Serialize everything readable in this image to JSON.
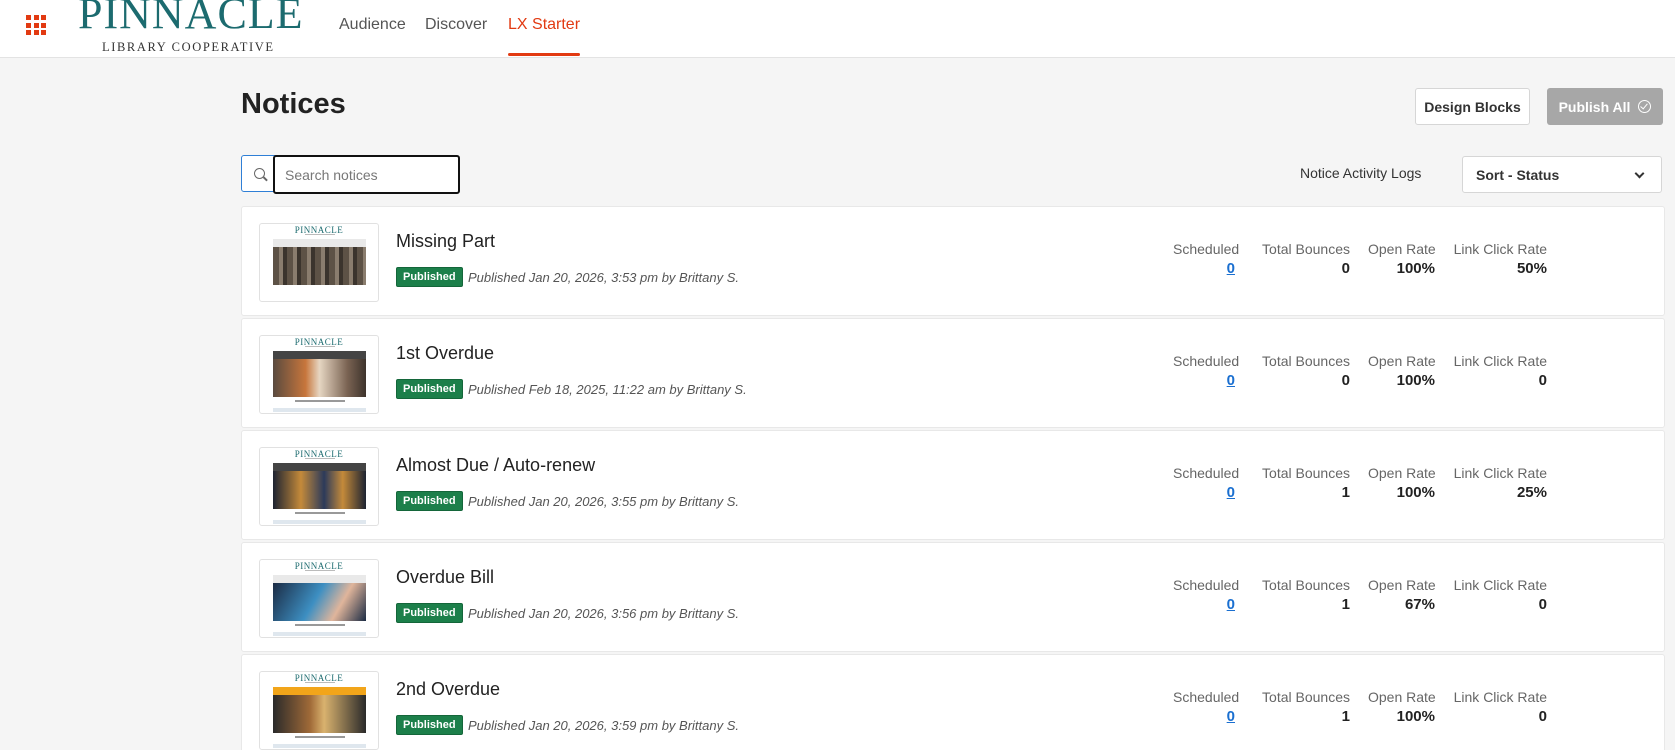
{
  "nav": {
    "logo_main": "PINNACLE",
    "logo_sub": "LIBRARY COOPERATIVE",
    "tabs": [
      {
        "label": "Audience",
        "active": false
      },
      {
        "label": "Discover",
        "active": false
      },
      {
        "label": "LX Starter",
        "active": true
      }
    ],
    "accent_color": "#e23a12"
  },
  "header": {
    "title": "Notices",
    "design_blocks_label": "Design Blocks",
    "publish_all_label": "Publish All"
  },
  "toolbar": {
    "search_placeholder": "Search notices",
    "search_value": "",
    "activity_logs_label": "Notice Activity Logs",
    "sort_label": "Sort - Status"
  },
  "stat_labels": {
    "scheduled": "Scheduled",
    "total_bounces": "Total Bounces",
    "open_rate": "Open Rate",
    "link_click_rate": "Link Click Rate"
  },
  "notices": [
    {
      "title": "Missing Part",
      "status": "Published",
      "meta": "Published Jan 20, 2026, 3:53 pm by Brittany  S.",
      "thumb_logo": "PINNACLE",
      "scheduled": "0",
      "total_bounces": "0",
      "open_rate": "100%",
      "link_click_rate": "50%"
    },
    {
      "title": "1st Overdue",
      "status": "Published",
      "meta": "Published Feb 18, 2025, 11:22 am by Brittany  S.",
      "thumb_logo": "PINNACLE",
      "scheduled": "0",
      "total_bounces": "0",
      "open_rate": "100%",
      "link_click_rate": "0"
    },
    {
      "title": "Almost Due / Auto-renew",
      "status": "Published",
      "meta": "Published Jan 20, 2026, 3:55 pm by Brittany  S.",
      "thumb_logo": "PINNACLE",
      "scheduled": "0",
      "total_bounces": "1",
      "open_rate": "100%",
      "link_click_rate": "25%"
    },
    {
      "title": "Overdue Bill",
      "status": "Published",
      "meta": "Published Jan 20, 2026, 3:56 pm by Brittany  S.",
      "thumb_logo": "PINNACLE",
      "scheduled": "0",
      "total_bounces": "1",
      "open_rate": "67%",
      "link_click_rate": "0"
    },
    {
      "title": "2nd Overdue",
      "status": "Published",
      "meta": "Published Jan 20, 2026, 3:59 pm by Brittany  S.",
      "thumb_logo": "PINNACLE",
      "scheduled": "0",
      "total_bounces": "1",
      "open_rate": "100%",
      "link_click_rate": "0"
    }
  ]
}
